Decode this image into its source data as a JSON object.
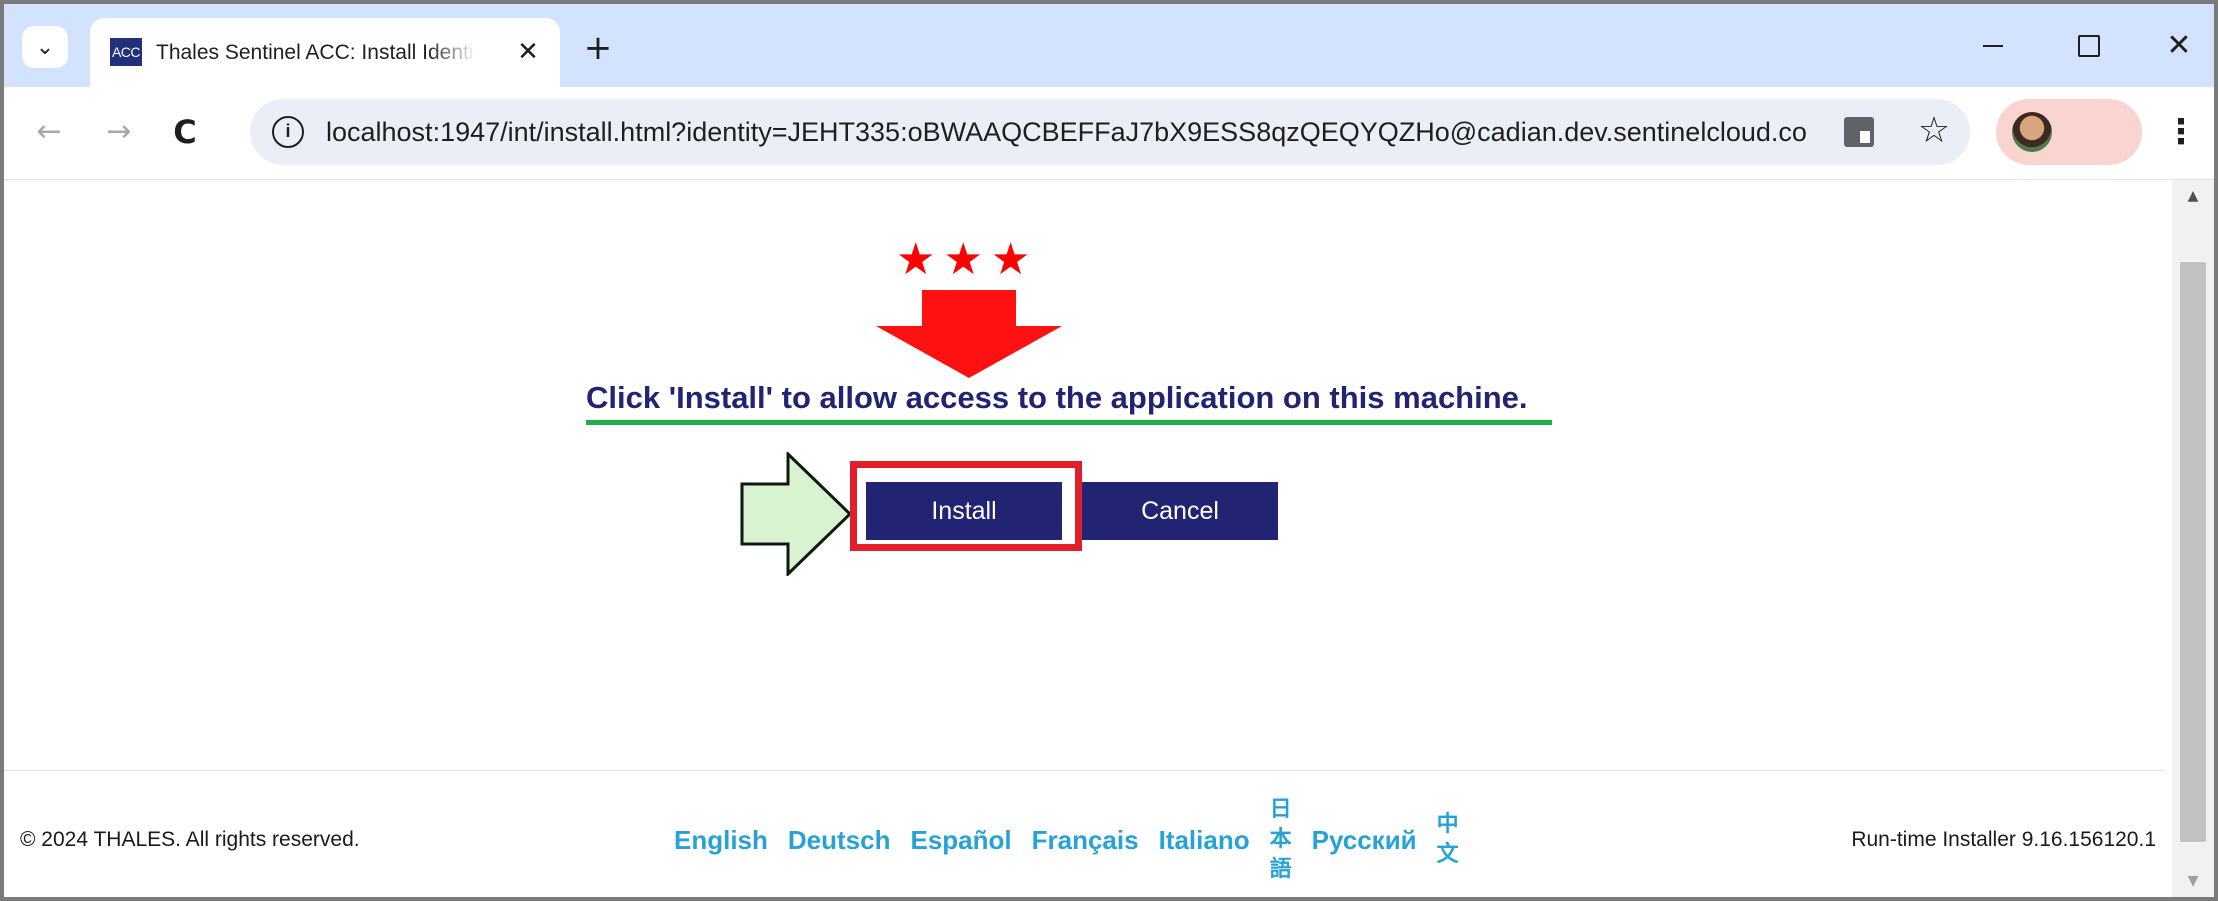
{
  "browser": {
    "tab": {
      "favicon_text": "ACC",
      "title": "Thales Sentinel ACC: Install Identity",
      "close_glyph": "✕"
    },
    "new_tab_glyph": "+",
    "tab_search_glyph": "⌄",
    "window": {
      "close_glyph": "✕"
    },
    "nav": {
      "back_glyph": "←",
      "forward_glyph": "→",
      "reload_glyph": "C"
    },
    "omnibox": {
      "site_info_glyph": "i",
      "url": "localhost:1947/int/install.html?identity=JEHT335:oBWAAQCBEFFaJ7bX9ESS8qzQEQYQZHo@cadian.dev.sentinelcloud.com"
    },
    "bookmark_glyph": "☆",
    "menu_glyph": "⋮",
    "scroll_up_glyph": "▲",
    "scroll_down_glyph": "▼"
  },
  "page": {
    "stars": "★★★",
    "headline": "Click 'Install' to allow access to the application on this machine.",
    "buttons": {
      "install": "Install",
      "cancel": "Cancel"
    },
    "footer": {
      "copyright": "© 2024 THALES. All rights reserved.",
      "languages": {
        "english": "English",
        "deutsch": "Deutsch",
        "espanol": "Español",
        "francais": "Français",
        "italiano": "Italiano",
        "japanese_chars": [
          "日",
          "本",
          "語"
        ],
        "russian": "Русский",
        "chinese_chars": [
          "中",
          "文"
        ]
      },
      "version": "Run-time Installer 9.16.156120.1"
    }
  },
  "colors": {
    "accent_navy": "#222373",
    "highlight_red": "#e11e2a",
    "underline_green": "#1fae47",
    "language_link_blue": "#26a3d4",
    "arrow_right_fill": "#d9f2d0"
  },
  "icons": {
    "tab_search": "chevron-down-icon",
    "close_tab": "close-icon",
    "new_tab": "plus-icon",
    "minimize": "minimize-icon",
    "maximize": "maximize-icon",
    "close_window": "close-icon",
    "back": "arrow-left-icon",
    "forward": "arrow-right-icon",
    "reload": "reload-icon",
    "site_info": "info-icon",
    "translate": "translate-icon",
    "bookmark": "star-icon",
    "profile": "avatar",
    "menu": "kebab-menu-icon"
  }
}
